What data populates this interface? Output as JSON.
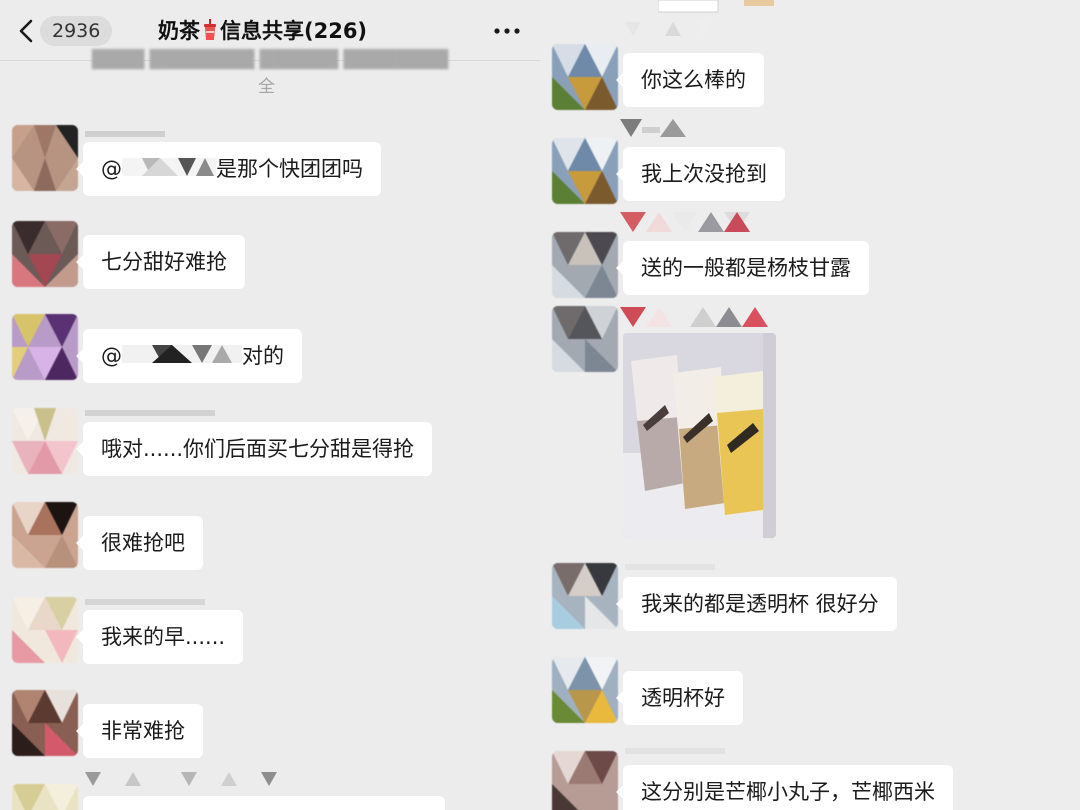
{
  "header": {
    "unread_count": "2936",
    "title_part1": "奶茶",
    "title_part2": "信息共享(226)",
    "notice_tail": "全"
  },
  "left_messages": [
    {
      "text_suffix": "是那个快团团吗",
      "mention_prefix": "@"
    },
    {
      "text": "七分甜好难抢"
    },
    {
      "text_suffix": "对的",
      "mention_prefix": "@"
    },
    {
      "text": "哦对......你们后面买七分甜是得抢"
    },
    {
      "text": "很难抢吧"
    },
    {
      "text": "我来的早......"
    },
    {
      "text": "非常难抢"
    }
  ],
  "right_messages": [
    {
      "text": "你这么棒的"
    },
    {
      "text": "我上次没抢到"
    },
    {
      "text": "送的一般都是杨枝甘露"
    },
    {
      "text": "我来的都是透明杯 很好分"
    },
    {
      "text": "透明杯好"
    },
    {
      "text": "这分别是芒椰小丸子，芒椰西米"
    }
  ],
  "icons": {
    "back": "chevron-left-icon",
    "more": "more-dots-icon",
    "title_emoji": "bubble-tea-icon"
  },
  "colors": {
    "background": "#ededed",
    "bubble": "#ffffff",
    "badge": "#dcdcdc"
  }
}
